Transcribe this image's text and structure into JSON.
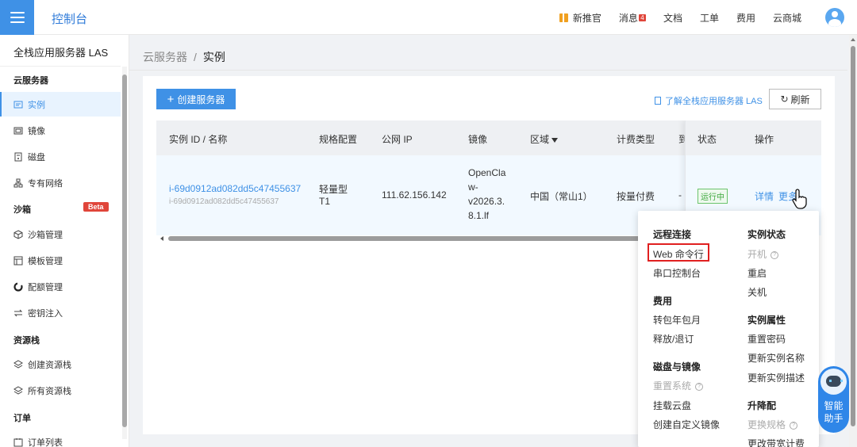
{
  "topbar": {
    "brand": "控制台",
    "nav": [
      "新推官",
      "消息",
      "文档",
      "工单",
      "费用",
      "云商城"
    ],
    "message_count": "4"
  },
  "sidebar": {
    "product": "全栈应用服务器 LAS",
    "groups": {
      "cloud_server": "云服务器",
      "sandbox": "沙箱",
      "resource_stack": "资源栈",
      "orders": "订单"
    },
    "items": [
      "实例",
      "镜像",
      "磁盘",
      "专有网络",
      "沙箱管理",
      "模板管理",
      "配额管理",
      "密钥注入",
      "创建资源栈",
      "所有资源栈",
      "订单列表"
    ],
    "beta_badge": "Beta"
  },
  "breadcrumb": {
    "parent": "云服务器",
    "separator": "/",
    "current": "实例"
  },
  "toolbar": {
    "create_label": "创建服务器",
    "learn_link": "了解全栈应用服务器 LAS",
    "refresh_label": "刷新"
  },
  "table": {
    "headers": [
      "实例 ID / 名称",
      "规格配置",
      "公网 IP",
      "镜像",
      "区域",
      "计费类型",
      "到",
      "状态",
      "操作"
    ],
    "row": {
      "id": "i-69d0912ad082dd5c47455637",
      "name": "i-69d0912ad082dd5c47455637",
      "spec_line1": "轻量型",
      "spec_line2": "T1",
      "ip": "111.62.156.142",
      "image_lines": [
        "OpenCla",
        "w-",
        "v2026.3.",
        "8.1.lf"
      ],
      "region": "中国（常山1）",
      "billing": "按量付费",
      "expire": "-",
      "status": "运行中",
      "action_detail": "详情",
      "action_more": "更多"
    }
  },
  "dropdown": {
    "remote": {
      "title": "远程连接",
      "items": [
        "Web 命令行",
        "串口控制台"
      ]
    },
    "fee": {
      "title": "费用",
      "items": [
        "转包年包月",
        "释放/退订"
      ]
    },
    "disk_image": {
      "title": "磁盘与镜像",
      "items": [
        "重置系统",
        "挂载云盘",
        "创建自定义镜像"
      ]
    },
    "instance_state": {
      "title": "实例状态",
      "items": [
        "开机",
        "重启",
        "关机"
      ]
    },
    "instance_attr": {
      "title": "实例属性",
      "items": [
        "重置密码",
        "更新实例名称",
        "更新实例描述"
      ]
    },
    "upgrade": {
      "title": "升降配",
      "items": [
        "更换规格",
        "更改带宽计费"
      ]
    }
  },
  "assistant": {
    "line1": "智能",
    "line2": "助手"
  },
  "colors": {
    "accent": "#3f91e6",
    "danger": "#e02020",
    "running": "#3da83d"
  }
}
